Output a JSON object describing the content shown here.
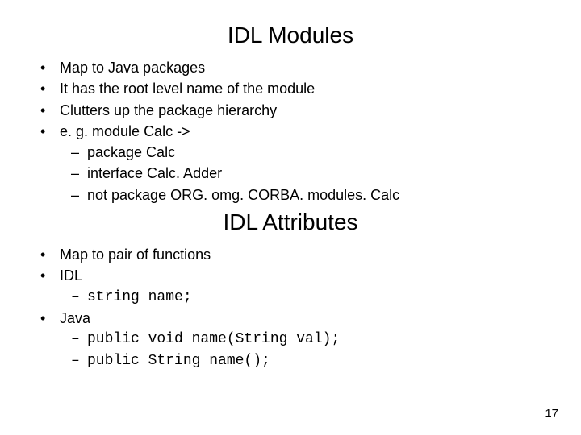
{
  "title1": "IDL Modules",
  "modules": {
    "b1": "Map to Java packages",
    "b2": "It has the root level name of the module",
    "b3": "Clutters up the package hierarchy",
    "b4": "e. g. module Calc ->",
    "b4s1": "package Calc",
    "b4s2": "interface Calc. Adder",
    "b4s3": "not package ORG. omg. CORBA. modules. Calc"
  },
  "title2": "IDL Attributes",
  "attrs": {
    "b1": "Map to pair of functions",
    "b2": "IDL",
    "b2s1": "string name;",
    "b3": "Java",
    "b3s1": "public void name(String val);",
    "b3s2": "public String name();"
  },
  "pagenum": "17"
}
